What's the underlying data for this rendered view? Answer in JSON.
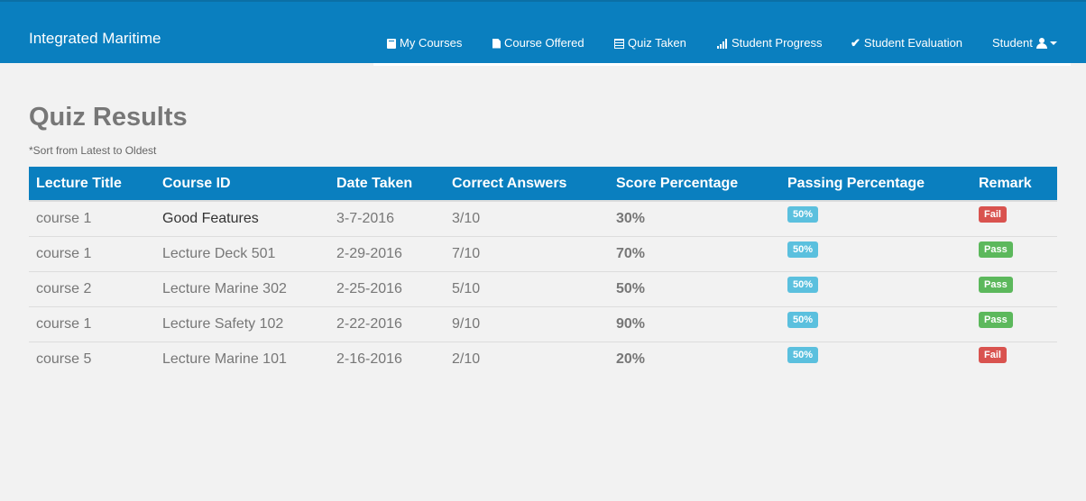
{
  "brand": "Integrated Maritime",
  "nav": {
    "my_courses": {
      "label": "My Courses",
      "icon": "book-icon"
    },
    "course_offered": {
      "label": "Course Offered",
      "icon": "file-icon"
    },
    "quiz_taken": {
      "label": "Quiz Taken",
      "icon": "list-icon"
    },
    "student_progress": {
      "label": "Student Progress",
      "icon": "signal-bars-icon"
    },
    "student_evaluation": {
      "label": "Student Evaluation",
      "icon": "check-icon"
    },
    "student": {
      "label": "Student",
      "icon": "user-icon"
    }
  },
  "page": {
    "title": "Quiz Results",
    "note": "*Sort from Latest to Oldest"
  },
  "table": {
    "headers": [
      "Lecture Title",
      "Course ID",
      "Date Taken",
      "Correct Answers",
      "Score Percentage",
      "Passing Percentage",
      "Remark"
    ],
    "rows": [
      {
        "lecture": "course 1",
        "course_id": "Good Features",
        "date": "3-7-2016",
        "correct": "3/10",
        "score": "30%",
        "passing": "50%",
        "remark": "Fail"
      },
      {
        "lecture": "course 1",
        "course_id": "Lecture Deck 501",
        "date": "2-29-2016",
        "correct": "7/10",
        "score": "70%",
        "passing": "50%",
        "remark": "Pass"
      },
      {
        "lecture": "course 2",
        "course_id": "Lecture Marine 302",
        "date": "2-25-2016",
        "correct": "5/10",
        "score": "50%",
        "passing": "50%",
        "remark": "Pass"
      },
      {
        "lecture": "course 1",
        "course_id": "Lecture Safety 102",
        "date": "2-22-2016",
        "correct": "9/10",
        "score": "90%",
        "passing": "50%",
        "remark": "Pass"
      },
      {
        "lecture": "course 5",
        "course_id": "Lecture Marine 101",
        "date": "2-16-2016",
        "correct": "2/10",
        "score": "20%",
        "passing": "50%",
        "remark": "Fail"
      }
    ]
  },
  "colors": {
    "navbar": "#0a7fbf",
    "pass": "#5cb85c",
    "fail": "#d9534f",
    "info": "#5bc0de"
  }
}
